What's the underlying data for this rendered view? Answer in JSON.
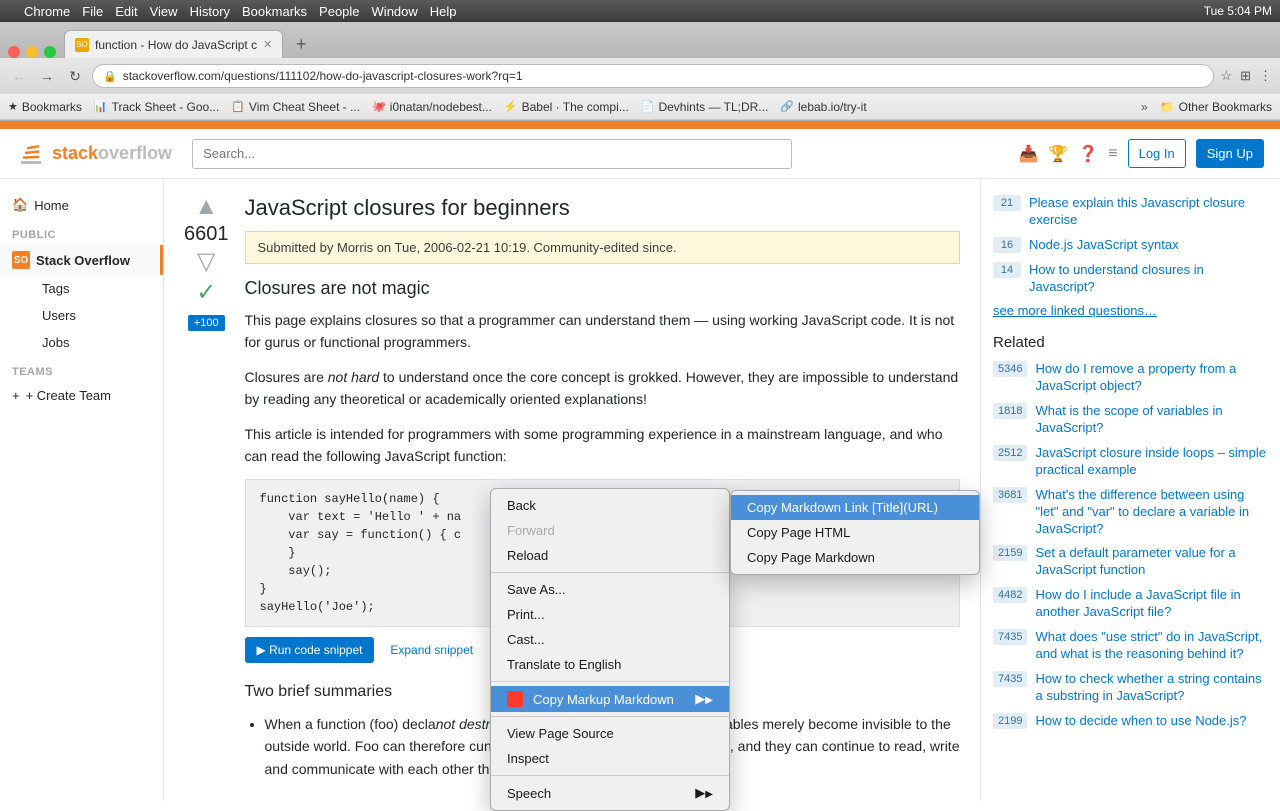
{
  "os": {
    "apple_menu": "",
    "time": "Tue 5:04 PM",
    "menus": [
      "Chrome",
      "File",
      "Edit",
      "View",
      "History",
      "Bookmarks",
      "People",
      "Window",
      "Help"
    ]
  },
  "browser": {
    "tab_title": "function - How do JavaScript c",
    "tab_favicon": "SO",
    "url": "https://stackoverflow.com/questions/111102/how-do-javascript-closures-work?rq=1",
    "url_host": "stackoverflow.com",
    "url_path": "/questions/111102/how-do-javascript-closures-work?rq=1",
    "bookmarks": [
      {
        "label": "Bookmarks",
        "icon": "★"
      },
      {
        "label": "Track Sheet - Goo...",
        "icon": "📊"
      },
      {
        "label": "Vim Cheat Sheet - ...",
        "icon": "📋"
      },
      {
        "label": "i0natan/nodebest...",
        "icon": "🐙"
      },
      {
        "label": "Babel · The compi...",
        "icon": "⚡"
      },
      {
        "label": "Devhints — TL;DR...",
        "icon": "📄"
      },
      {
        "label": "lebab.io/try-it",
        "icon": "🔗"
      }
    ],
    "bookmarks_more": "»",
    "other_bookmarks": "Other Bookmarks"
  },
  "so_header": {
    "search_placeholder": "Search...",
    "login_label": "Log In",
    "signup_label": "Sign Up"
  },
  "sidebar": {
    "home_label": "Home",
    "public_label": "PUBLIC",
    "stackoverflow_label": "Stack Overflow",
    "tags_label": "Tags",
    "users_label": "Users",
    "jobs_label": "Jobs",
    "teams_label": "TEAMS",
    "create_team_label": "+ Create Team"
  },
  "question": {
    "title": "JavaScript closures for beginners",
    "vote_count": "6601",
    "vote_up": "▲",
    "vote_down": "▽",
    "accepted": "✓",
    "bounty": "+100",
    "community_notice": "Submitted by Morris on Tue, 2006-02-21 10:19. Community-edited since.",
    "answer_title": "Closures are not magic",
    "answer_p1": "This page explains closures so that a programmer can understand them — using working JavaScript code. It is not for gurus or functional programmers.",
    "answer_p2_before": "Closures are ",
    "answer_p2_em": "not hard",
    "answer_p2_after": " to understand once the core concept is grokked. However, they are impossible to understand by reading any theoretical or academically oriented explanations!",
    "answer_p3": "This article is intended for programmers with some programming experience in a mainstream language, and who can read the following JavaScript function:",
    "code": "function sayHello(name) {\n    var text = 'Hello ' + na\n    var say = function() { c\n    }\n    say();\n}\nsayHello('Joe');",
    "run_btn": "▶ Run code snippet",
    "expand_link": "Expand snippet",
    "two_summaries_title": "Two brief summaries",
    "bullet1_before": "When a function (foo) decla",
    "bullet1_em": "not destroyed",
    "bullet1_after": " when the function exits. The variables merely become invisible to the outside world. Foo can therefore cunningly return the functions bar and baz, and they can continue to read, write and communicate with each other through this closed-off family of"
  },
  "linked": {
    "items": [
      {
        "score": "21",
        "text": "Please explain this Javascript closure exercise"
      },
      {
        "score": "16",
        "text": "Node.js JavaScript syntax"
      },
      {
        "score": "14",
        "text": "How to understand closures in Javascript?"
      }
    ],
    "see_more": "see more linked questions…"
  },
  "related": {
    "header": "Related",
    "items": [
      {
        "score": "5346",
        "text": "How do I remove a property from a JavaScript object?"
      },
      {
        "score": "1818",
        "text": "What is the scope of variables in JavaScript?"
      },
      {
        "score": "2512",
        "text": "JavaScript closure inside loops – simple practical example"
      },
      {
        "score": "3681",
        "text": "What's the difference between using \"let\" and \"var\" to declare a variable in JavaScript?"
      },
      {
        "score": "2159",
        "text": "Set a default parameter value for a JavaScript function"
      },
      {
        "score": "4482",
        "text": "How do I include a JavaScript file in another JavaScript file?"
      },
      {
        "score": "7435",
        "text": "What does \"use strict\" do in JavaScript, and what is the reasoning behind it?"
      },
      {
        "score": "7435",
        "text": "How to check whether a string contains a substring in JavaScript?"
      },
      {
        "score": "2199",
        "text": "How to decide when to use Node.js?"
      }
    ]
  },
  "context_menu": {
    "items": [
      {
        "label": "Back",
        "enabled": true
      },
      {
        "label": "Forward",
        "enabled": false
      },
      {
        "label": "Reload",
        "enabled": true
      },
      {
        "separator": true
      },
      {
        "label": "Save As...",
        "enabled": true
      },
      {
        "label": "Print...",
        "enabled": true
      },
      {
        "label": "Cast...",
        "enabled": true
      },
      {
        "label": "Translate to English",
        "enabled": true
      },
      {
        "separator": true
      },
      {
        "label": "Copy Markup Markdown",
        "enabled": true,
        "highlighted": true,
        "has_icon": true,
        "has_submenu": true
      },
      {
        "separator": true
      },
      {
        "label": "View Page Source",
        "enabled": true
      },
      {
        "label": "Inspect",
        "enabled": true
      },
      {
        "separator": true
      },
      {
        "label": "Speech",
        "enabled": true,
        "has_submenu": true
      }
    ],
    "submenu": [
      {
        "label": "Copy Markdown Link [Title](URL)",
        "highlighted": true
      },
      {
        "label": "Copy Page HTML"
      },
      {
        "label": "Copy Page Markdown"
      }
    ]
  }
}
